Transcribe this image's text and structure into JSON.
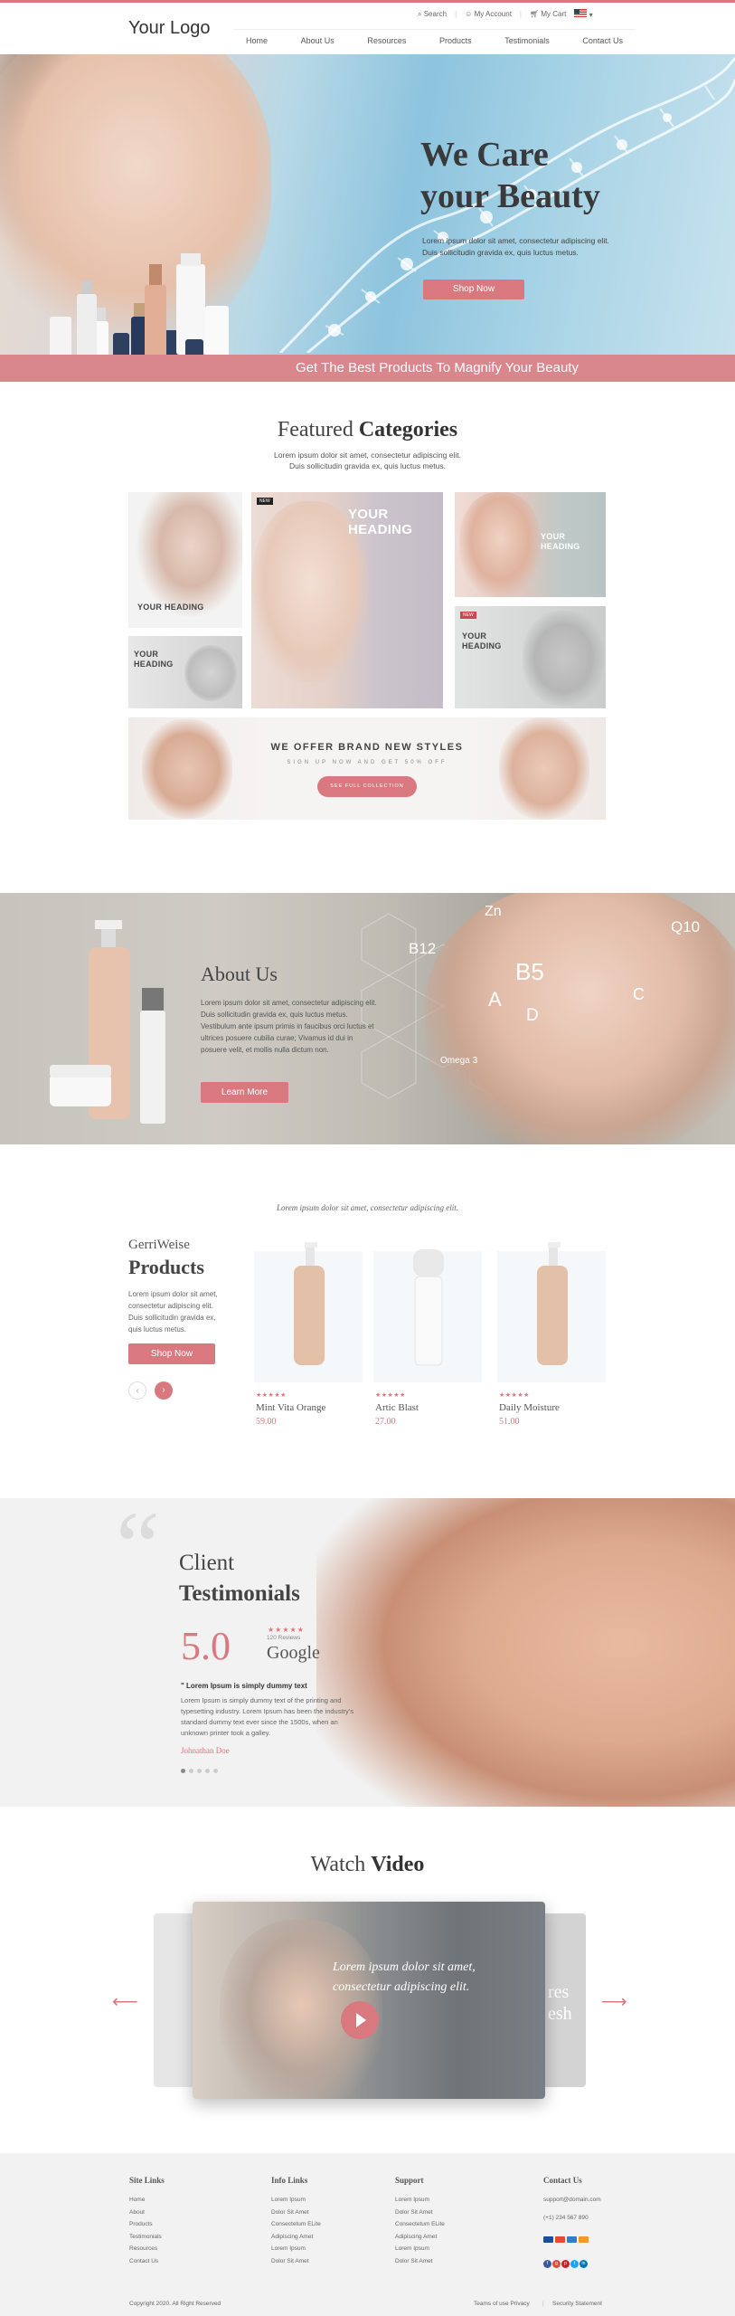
{
  "header": {
    "logo": "Your Logo",
    "search": "Search",
    "my_account": "My Account",
    "my_cart": "My Cart",
    "nav": [
      "Home",
      "About Us",
      "Resources",
      "Products",
      "Testimonials",
      "Contact Us"
    ]
  },
  "hero": {
    "title_line1": "We Care",
    "title_line2": "your Beauty",
    "text_line1": "Lorem ipsum dolor sit amet, consectetur adipiscing elit.",
    "text_line2": "Duis sollicitudin gravida ex, quis luctus metus.",
    "button": "Shop Now",
    "strip": "Get The Best Products To Magnify Your Beauty"
  },
  "categories": {
    "title_light": "Featured ",
    "title_bold": "Categories",
    "sub_line1": "Lorem ipsum dolor sit amet, consectetur adipiscing elit.",
    "sub_line2": "Duis sollicitudin gravida ex, quis luctus metus.",
    "tile_heading_1": "YOUR HEADING",
    "tile_heading_2": "YOUR HEADING",
    "tile_heading_3": "YOUR HEADING",
    "tile_heading_4": "YOUR HEADING",
    "tile_heading_5": "YOUR HEADING",
    "new_tag": "NEW",
    "banner_title": "WE OFFER BRAND NEW STYLES",
    "banner_sub": "SIGN UP NOW AND GET 50% OFF",
    "banner_button": "SEE FULL COLLECTION"
  },
  "about": {
    "title": "About Us",
    "text": "Lorem ipsum dolor sit amet, consectetur adipiscing elit. Duis sollicitudin gravida ex, quis luctus metus. Vestibulum ante ipsum primis in faucibus orci luctus et ultrices posuere cubilia curae; Vivamus id dui in posuere velit, et mollis nulla dictum non.",
    "button": "Learn More",
    "vitamins": [
      "Zn",
      "B12",
      "B5",
      "Q10",
      "A",
      "D",
      "C",
      "Omega 3"
    ]
  },
  "products": {
    "intro": "Lorem ipsum dolor sit amet, consectetur adipiscing elit.",
    "brand": "GerriWeise",
    "title": "Products",
    "text": "Lorem ipsum dolor sit amet, consectetur adipiscing elit. Duis sollicitudin gravida ex, quis luctus metus.",
    "button": "Shop Now",
    "items": [
      {
        "name": "Mint Vita Orange",
        "price": "59.00",
        "stars": "★★★★★"
      },
      {
        "name": "Artic Blast",
        "price": "27.00",
        "stars": "★★★★★"
      },
      {
        "name": "Daily Moisture",
        "price": "51.00",
        "stars": "★★★★★"
      }
    ]
  },
  "testimonials": {
    "title_light": "Client",
    "title_bold": "Testimonials",
    "rating": "5.0",
    "stars": "★★★★★",
    "review_count": "120 Reviews",
    "source": "Google",
    "quote_title": "\" Lorem Ipsum is simply dummy text",
    "quote_text": "Lorem Ipsum is simply dummy text of the printing and typesetting industry. Lorem Ipsum has been the industry's standard dummy text ever since the 1500s, when an unknown printer took a galley.",
    "author": "Johnathan Doe"
  },
  "video": {
    "title_light": "Watch ",
    "title_bold": "Video",
    "caption_line1": "Lorem ipsum dolor sit amet,",
    "caption_line2": "consectetur adipiscing elit.",
    "side_text_line1": "res",
    "side_text_line2": "esh"
  },
  "footer": {
    "cols": [
      {
        "title": "Site Links",
        "items": [
          "Home",
          "About",
          "Products",
          "Testimonials",
          "Resources",
          "Contact Us"
        ]
      },
      {
        "title": "Info Links",
        "items": [
          "Lorem Ipsum",
          "Dolor Sit Amet",
          "Consectetum ELite",
          "Adipiscing Amet",
          "Lorem Ipsum",
          "Dolor Sit Amet"
        ]
      },
      {
        "title": "Support",
        "items": [
          "Lorem Ipsum",
          "Dolor Sit Amet",
          "Consectetum ELite",
          "Adipiscing Amet",
          "Lorem Ipsum",
          "Dolor Sit Amet"
        ]
      }
    ],
    "contact_title": "Contact Us",
    "email": "support@domain.com",
    "phone": "(+1) 234 567 890",
    "copyright": "Copyright  2020.  All Right Reserved",
    "terms": "Teams of use Privacy",
    "security": "Security Statement"
  }
}
